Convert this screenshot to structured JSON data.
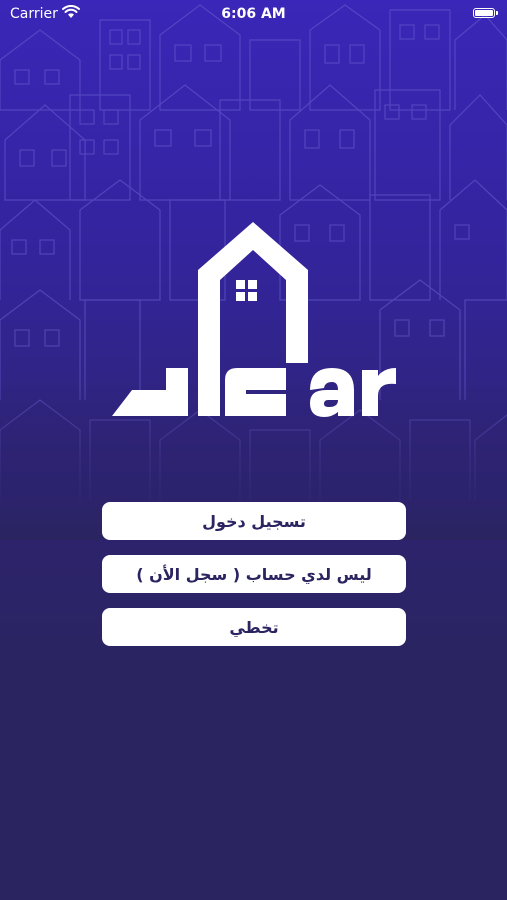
{
  "status_bar": {
    "carrier": "Carrier",
    "time": "6:06 AM",
    "wifi_icon": "wifi-icon",
    "battery_icon": "battery-icon"
  },
  "logo": {
    "text": "Dar",
    "icon": "house-logo-icon"
  },
  "buttons": {
    "login": "تسجيل دخول",
    "register": "ليس لدي حساب ( سجل الأن )",
    "skip": "تخطي"
  },
  "colors": {
    "background_top": "#3a26b8",
    "background_bottom": "#2a2460",
    "button_bg": "#ffffff",
    "button_text": "#2a2460"
  }
}
